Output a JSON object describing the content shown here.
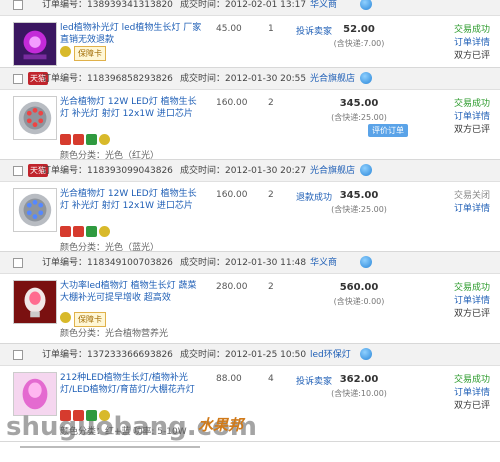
{
  "labels": {
    "order_no": "订单编号：",
    "order_time": "成交时间："
  },
  "orders": [
    {
      "order_no": "138939341313820",
      "time": "2012-02-01 13:17",
      "shop": "华义商",
      "badge": "",
      "title": "led植物补光灯 led植物生长灯 厂家直销无效退款",
      "tag": "保障卡",
      "attr": "",
      "price": "45.00",
      "qty": "1",
      "service": "投诉卖家",
      "total": "52.00",
      "shipping": "(含快递:7.00)",
      "pay_button": "",
      "status": [
        "交易成功",
        "订单详情",
        "双方已评",
        ""
      ]
    },
    {
      "order_no": "118396858293826",
      "time": "2012-01-30 20:55",
      "shop": "光合旗舰店",
      "badge": "天猫",
      "title": "光合植物灯 12W LED灯 植物生长灯 补光灯 射灯 12x1W 进口芯片",
      "tag": "",
      "attr": "颜色分类：光色（红光）",
      "price": "160.00",
      "qty": "2",
      "service": "",
      "total": "345.00",
      "shipping": "(含快递:25.00)",
      "pay_button": "评价订单",
      "status": [
        "交易成功",
        "订单详情",
        "双方已评",
        ""
      ]
    },
    {
      "order_no": "118393099043826",
      "time": "2012-01-30 20:27",
      "shop": "光合旗舰店",
      "badge": "天猫",
      "title": "光合植物灯 12W LED灯 植物生长灯 补光灯 射灯 12x1W 进口芯片",
      "tag": "",
      "attr": "颜色分类：光色（蓝光）",
      "price": "160.00",
      "qty": "2",
      "service": "退款成功",
      "total": "345.00",
      "shipping": "(含快递:25.00)",
      "pay_button": "",
      "status": [
        "交易关闭",
        "订单详情",
        "",
        ""
      ]
    },
    {
      "order_no": "118349100703826",
      "time": "2012-01-30 11:48",
      "shop": "华义商",
      "badge": "",
      "title": "大功率led植物灯 植物生长灯 蔬菜大棚补光可提早增收 超高效",
      "tag": "保障卡",
      "attr": "颜色分类：光合植物营养光",
      "price": "280.00",
      "qty": "2",
      "service": "",
      "total": "560.00",
      "shipping": "(含快递:0.00)",
      "pay_button": "",
      "status": [
        "交易成功",
        "订单详情",
        "双方已评",
        ""
      ]
    },
    {
      "order_no": "137233366693826",
      "time": "2012-01-25 10:50",
      "shop": "led环保灯",
      "badge": "",
      "title": "212种LED植物生长灯/植物补光灯/LED植物灯/育苗灯/大棚花卉灯",
      "tag": "",
      "attr": "颜色分类：红+蓝 功率: 5-10W",
      "price": "88.00",
      "qty": "4",
      "service": "投诉卖家",
      "total": "362.00",
      "shipping": "(含快递:10.00)",
      "pay_button": "",
      "status": [
        "交易成功",
        "订单详情",
        "双方已评",
        ""
      ]
    }
  ],
  "watermark": {
    "text": "shuguobang.com",
    "brand": "水果邦"
  }
}
